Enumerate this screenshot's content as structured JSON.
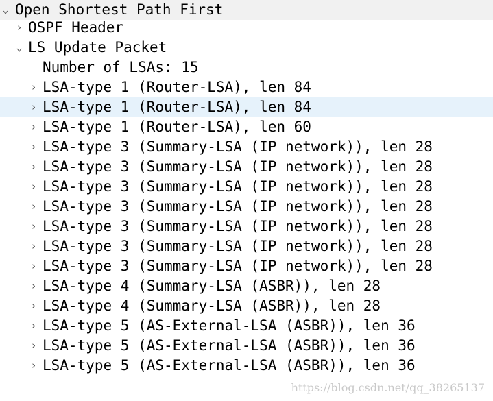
{
  "colors": {
    "root_row_background": "#f1f1f1",
    "selected_row_background": "#e6f2fb",
    "expander_color": "#5a5a5a",
    "watermark_color": "#c9c9c9"
  },
  "tree": {
    "root": {
      "label": "Open Shortest Path First",
      "expanded": true,
      "expander_icon": "chevron-down-icon"
    },
    "ospf_header": {
      "label": "OSPF Header",
      "expanded": false,
      "expander_icon": "chevron-right-icon"
    },
    "ls_update": {
      "label": "LS Update Packet",
      "expanded": true,
      "expander_icon": "chevron-down-icon"
    },
    "lsa_count": {
      "label": "Number of LSAs: 15"
    },
    "lsas": [
      {
        "label": "LSA-type 1 (Router-LSA), len 84",
        "selected": false,
        "expander_icon": "chevron-right-icon"
      },
      {
        "label": "LSA-type 1 (Router-LSA), len 84",
        "selected": true,
        "expander_icon": "chevron-right-icon"
      },
      {
        "label": "LSA-type 1 (Router-LSA), len 60",
        "selected": false,
        "expander_icon": "chevron-right-icon"
      },
      {
        "label": "LSA-type 3 (Summary-LSA (IP network)), len 28",
        "selected": false,
        "expander_icon": "chevron-right-icon"
      },
      {
        "label": "LSA-type 3 (Summary-LSA (IP network)), len 28",
        "selected": false,
        "expander_icon": "chevron-right-icon"
      },
      {
        "label": "LSA-type 3 (Summary-LSA (IP network)), len 28",
        "selected": false,
        "expander_icon": "chevron-right-icon"
      },
      {
        "label": "LSA-type 3 (Summary-LSA (IP network)), len 28",
        "selected": false,
        "expander_icon": "chevron-right-icon"
      },
      {
        "label": "LSA-type 3 (Summary-LSA (IP network)), len 28",
        "selected": false,
        "expander_icon": "chevron-right-icon"
      },
      {
        "label": "LSA-type 3 (Summary-LSA (IP network)), len 28",
        "selected": false,
        "expander_icon": "chevron-right-icon"
      },
      {
        "label": "LSA-type 3 (Summary-LSA (IP network)), len 28",
        "selected": false,
        "expander_icon": "chevron-right-icon"
      },
      {
        "label": "LSA-type 4 (Summary-LSA (ASBR)), len 28",
        "selected": false,
        "expander_icon": "chevron-right-icon"
      },
      {
        "label": "LSA-type 4 (Summary-LSA (ASBR)), len 28",
        "selected": false,
        "expander_icon": "chevron-right-icon"
      },
      {
        "label": "LSA-type 5 (AS-External-LSA (ASBR)), len 36",
        "selected": false,
        "expander_icon": "chevron-right-icon"
      },
      {
        "label": "LSA-type 5 (AS-External-LSA (ASBR)), len 36",
        "selected": false,
        "expander_icon": "chevron-right-icon"
      },
      {
        "label": "LSA-type 5 (AS-External-LSA (ASBR)), len 36",
        "selected": false,
        "expander_icon": "chevron-right-icon"
      }
    ]
  },
  "watermark": "https://blog.csdn.net/qq_38265137"
}
